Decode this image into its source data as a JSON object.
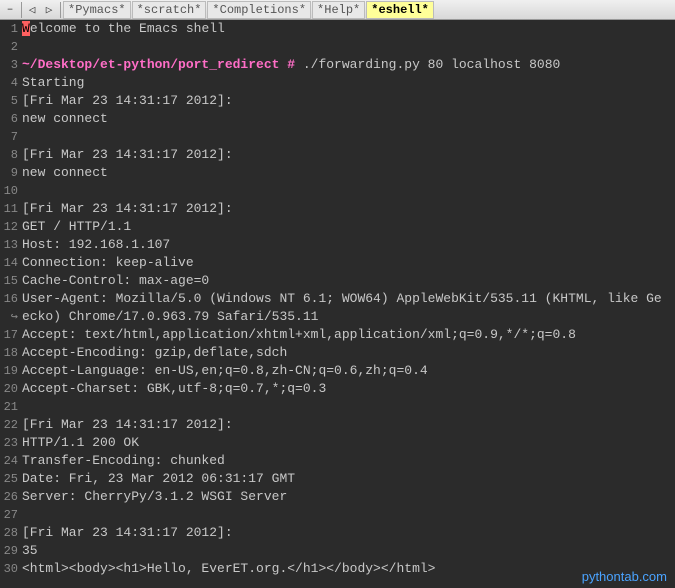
{
  "toolbar": {
    "nav": {
      "min": "–",
      "back": "◁",
      "fwd": "▷"
    },
    "tabs": [
      {
        "label": "*Pymacs*",
        "active": false
      },
      {
        "label": "*scratch*",
        "active": false
      },
      {
        "label": "*Completions*",
        "active": false
      },
      {
        "label": "*Help*",
        "active": false
      },
      {
        "label": "*eshell*",
        "active": true
      }
    ]
  },
  "buffer": {
    "lines": [
      {
        "n": 1,
        "type": "welcome",
        "cursor": "W",
        "rest": "elcome to the Emacs shell"
      },
      {
        "n": 2,
        "type": "blank",
        "text": ""
      },
      {
        "n": 3,
        "type": "prompt",
        "prompt": "~/Desktop/et-python/port_redirect #",
        "cmd": " ./forwarding.py 80 localhost 8080"
      },
      {
        "n": 4,
        "type": "plain",
        "text": "Starting"
      },
      {
        "n": 5,
        "type": "plain",
        "text": "[Fri Mar 23 14:31:17 2012]:"
      },
      {
        "n": 6,
        "type": "plain",
        "text": "new connect"
      },
      {
        "n": 7,
        "type": "blank",
        "text": ""
      },
      {
        "n": 8,
        "type": "plain",
        "text": "[Fri Mar 23 14:31:17 2012]:"
      },
      {
        "n": 9,
        "type": "plain",
        "text": "new connect"
      },
      {
        "n": 10,
        "type": "blank",
        "text": ""
      },
      {
        "n": 11,
        "type": "plain",
        "text": "[Fri Mar 23 14:31:17 2012]:"
      },
      {
        "n": 12,
        "type": "plain",
        "text": "GET / HTTP/1.1"
      },
      {
        "n": 13,
        "type": "plain",
        "text": "Host: 192.168.1.107"
      },
      {
        "n": 14,
        "type": "plain",
        "text": "Connection: keep-alive"
      },
      {
        "n": 15,
        "type": "plain",
        "text": "Cache-Control: max-age=0"
      },
      {
        "n": 16,
        "type": "plain",
        "text": "User-Agent: Mozilla/5.0 (Windows NT 6.1; WOW64) AppleWebKit/535.11 (KHTML, like Ge"
      },
      {
        "n": "",
        "type": "wrap",
        "wrap": "↪",
        "text": "ecko) Chrome/17.0.963.79 Safari/535.11"
      },
      {
        "n": 17,
        "type": "plain",
        "text": "Accept: text/html,application/xhtml+xml,application/xml;q=0.9,*/*;q=0.8"
      },
      {
        "n": 18,
        "type": "plain",
        "text": "Accept-Encoding: gzip,deflate,sdch"
      },
      {
        "n": 19,
        "type": "plain",
        "text": "Accept-Language: en-US,en;q=0.8,zh-CN;q=0.6,zh;q=0.4"
      },
      {
        "n": 20,
        "type": "plain",
        "text": "Accept-Charset: GBK,utf-8;q=0.7,*;q=0.3"
      },
      {
        "n": 21,
        "type": "blank",
        "text": ""
      },
      {
        "n": 22,
        "type": "plain",
        "text": "[Fri Mar 23 14:31:17 2012]:"
      },
      {
        "n": 23,
        "type": "plain",
        "text": "HTTP/1.1 200 OK"
      },
      {
        "n": 24,
        "type": "plain",
        "text": "Transfer-Encoding: chunked"
      },
      {
        "n": 25,
        "type": "plain",
        "text": "Date: Fri, 23 Mar 2012 06:31:17 GMT"
      },
      {
        "n": 26,
        "type": "plain",
        "text": "Server: CherryPy/3.1.2 WSGI Server"
      },
      {
        "n": 27,
        "type": "blank",
        "text": ""
      },
      {
        "n": 28,
        "type": "plain",
        "text": "[Fri Mar 23 14:31:17 2012]:"
      },
      {
        "n": 29,
        "type": "plain",
        "text": "35"
      },
      {
        "n": 30,
        "type": "plain",
        "text": "<html><body><h1>Hello, EverET.org.</h1></body></html>"
      }
    ]
  },
  "watermark": "pythontab.com"
}
